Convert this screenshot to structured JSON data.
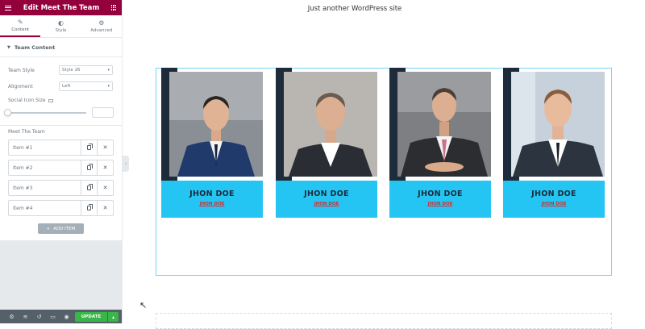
{
  "panel": {
    "title": "Edit Meet The Team",
    "tabs": [
      {
        "label": "Content",
        "icon": "pencil-icon"
      },
      {
        "label": "Style",
        "icon": "half-circle-icon"
      },
      {
        "label": "Advanced",
        "icon": "gear-icon"
      }
    ],
    "section_title": "Team Content",
    "team_style_label": "Team Style",
    "team_style_value": "Style 26",
    "alignment_label": "Alignment",
    "alignment_value": "Left",
    "social_icon_size_label": "Social Icon Size",
    "meet_the_team_label": "Meet The Team",
    "items": [
      "Item #1",
      "Item #2",
      "Item #3",
      "Item #4"
    ],
    "add_item_label": "ADD ITEM",
    "update_label": "UPDATE"
  },
  "preview": {
    "tagline": "Just another WordPress site",
    "members": [
      {
        "name": "JHON DOE",
        "role": "JHON DOE"
      },
      {
        "name": "JHON DOE",
        "role": "JHON DOE"
      },
      {
        "name": "JHON DOE",
        "role": "JHON DOE"
      },
      {
        "name": "JHON DOE",
        "role": "JHON DOE"
      }
    ]
  },
  "colors": {
    "brand": "#93003c",
    "card_dark": "#1d2b3a",
    "card_accent": "#24c5f3",
    "role_text": "#d32f2f",
    "update_green": "#39b54a"
  }
}
